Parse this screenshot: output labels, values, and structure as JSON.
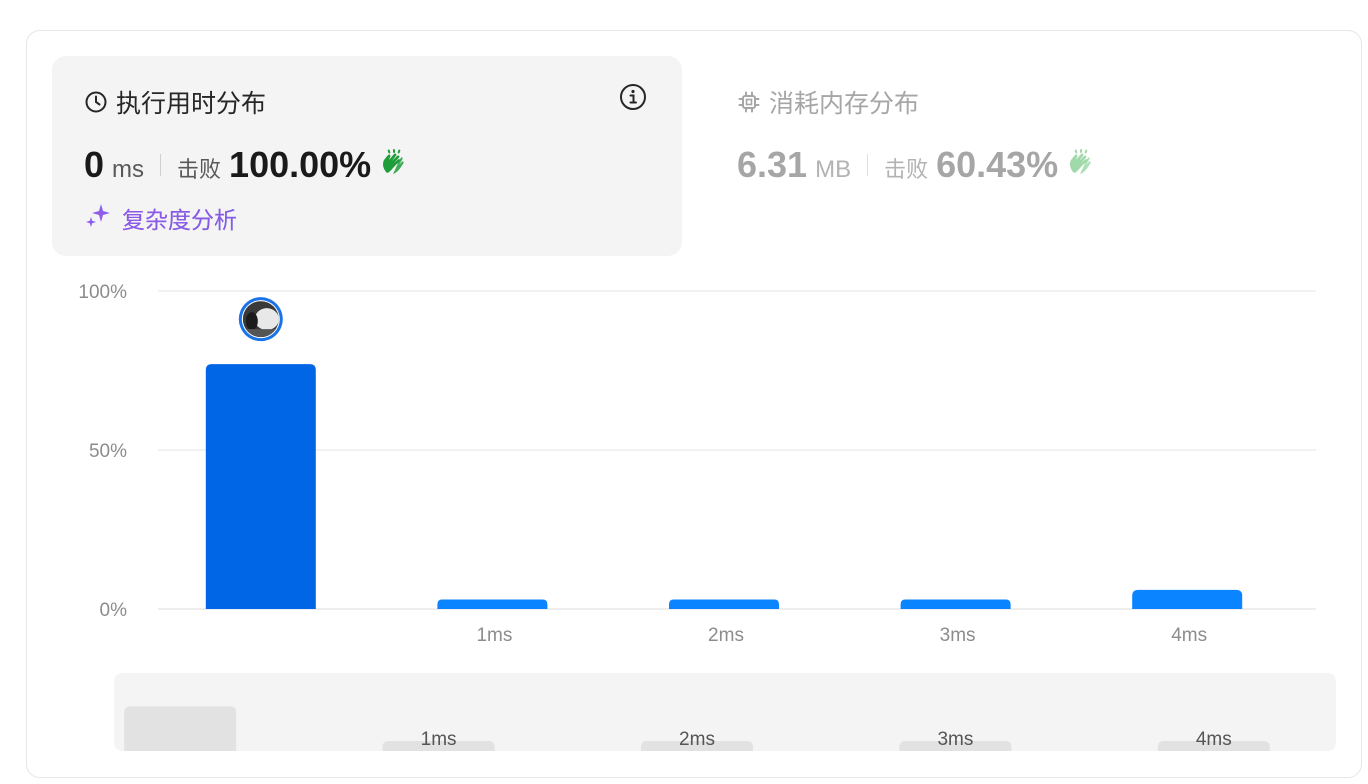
{
  "runtime_panel": {
    "title": "执行用时分布",
    "value": "0",
    "unit": "ms",
    "beat_label": "击败",
    "beat_percent": "100.00%",
    "complexity_label": "复杂度分析",
    "icons": [
      "clock-icon",
      "info-icon",
      "clap-icon",
      "sparkle-icon"
    ]
  },
  "memory_panel": {
    "title": "消耗内存分布",
    "value": "6.31",
    "unit": "MB",
    "beat_label": "击败",
    "beat_percent": "60.43%",
    "icons": [
      "chip-icon",
      "clap-icon"
    ]
  },
  "colors": {
    "bar_selected": "#0066e6",
    "bar": "#0a84ff",
    "clap_active": "#1f9d3a",
    "clap_muted": "#9fd9a9",
    "grid": "#e6e6e6",
    "tick_text": "#8c8c8c",
    "navigator_bar": "#e2e2e2",
    "complexity_accent": "#8a5ae6"
  },
  "chart_data": {
    "type": "bar",
    "categories": [
      "",
      "1ms",
      "2ms",
      "3ms",
      "4ms"
    ],
    "values": [
      77,
      3,
      3,
      3,
      6
    ],
    "y_ticks": [
      "100%",
      "50%",
      "0%"
    ],
    "ylim": [
      0,
      100
    ],
    "highlight_index": 0,
    "grid": true,
    "navigator": {
      "categories": [
        "",
        "1ms",
        "2ms",
        "3ms",
        "4ms"
      ],
      "values": [
        77,
        3,
        3,
        3,
        6
      ]
    }
  }
}
